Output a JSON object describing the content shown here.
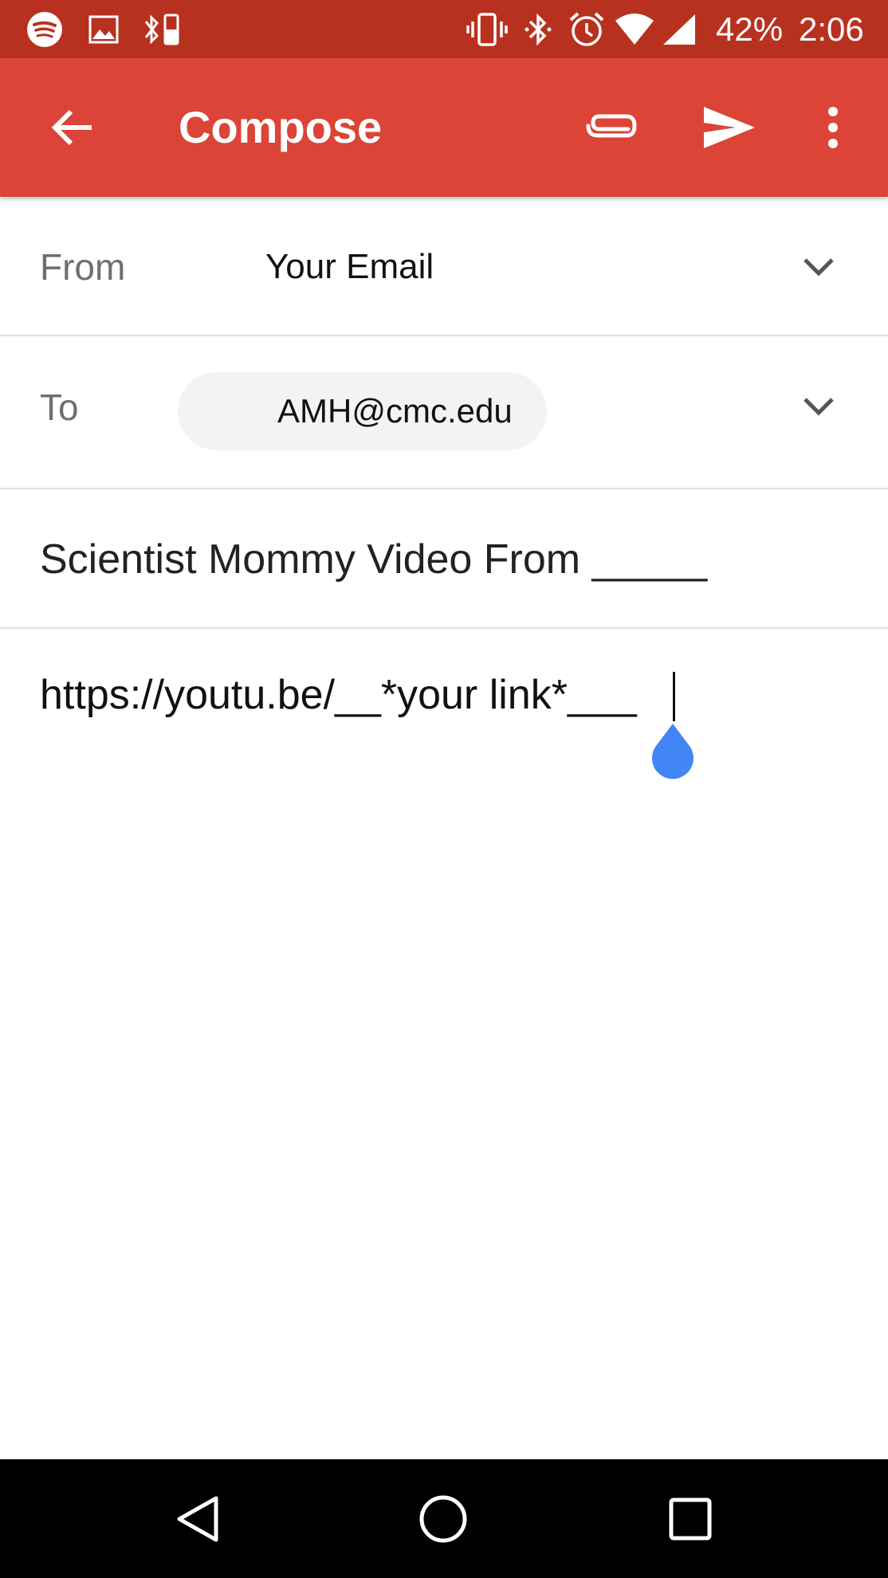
{
  "status_bar": {
    "battery_percent": "42%",
    "time": "2:06",
    "icons_left": [
      "spotify-icon",
      "image-icon",
      "bluetooth-battery-icon"
    ],
    "icons_right": [
      "vibrate-icon",
      "bluetooth-icon",
      "alarm-icon",
      "wifi-icon",
      "signal-icon"
    ]
  },
  "app_bar": {
    "title": "Compose",
    "actions": [
      "back-arrow-icon",
      "attach-icon",
      "send-icon",
      "more-vert-icon"
    ]
  },
  "from": {
    "label": "From",
    "value": "Your Email"
  },
  "to": {
    "label": "To",
    "recipient": "AMH@cmc.edu"
  },
  "subject": "Scientist Mommy Video From _____",
  "body": "https://youtu.be/__*your link*___",
  "colors": {
    "status_bar": "#b8311f",
    "app_bar": "#db4437",
    "cursor_handle": "#4285f4",
    "nav_bar": "#000000"
  },
  "nav_bar": {
    "buttons": [
      "back-icon",
      "home-icon",
      "recents-icon"
    ]
  }
}
